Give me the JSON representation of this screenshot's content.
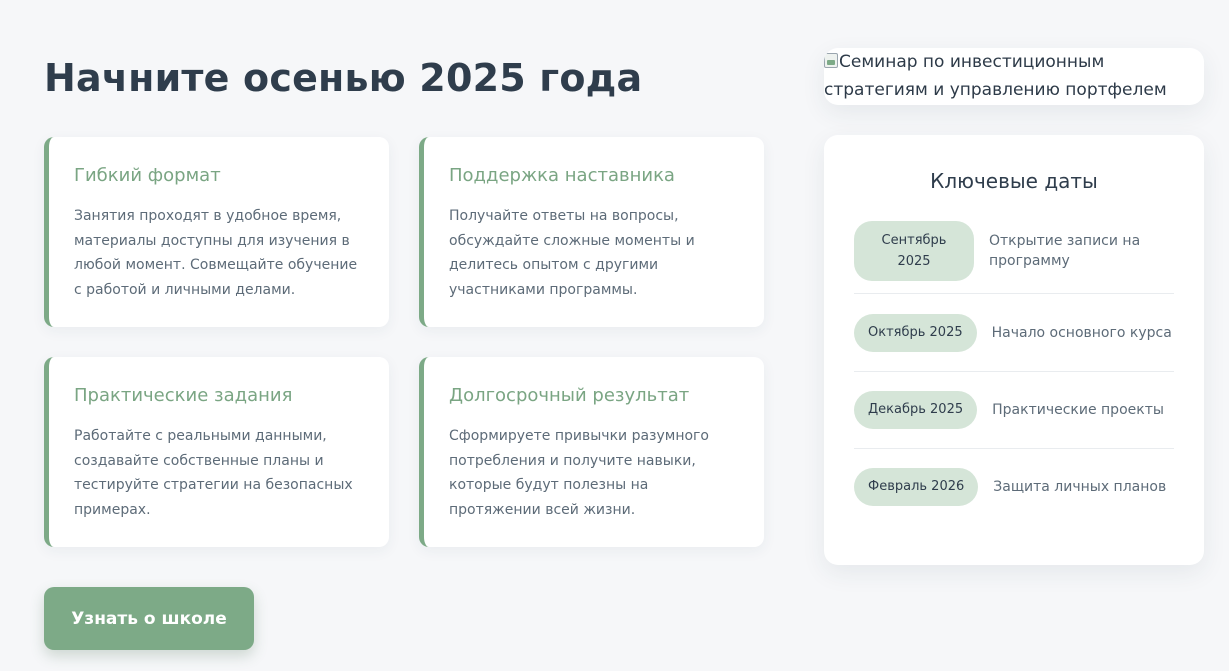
{
  "page": {
    "title": "Начните осенью 2025 года"
  },
  "features": [
    {
      "title": "Гибкий формат",
      "text": "Занятия проходят в удобное время, материалы доступны для изучения в любой момент. Совмещайте обучение с работой и личными делами."
    },
    {
      "title": "Поддержка наставника",
      "text": "Получайте ответы на вопросы, обсуждайте сложные моменты и делитесь опытом с другими участниками программы."
    },
    {
      "title": "Практические задания",
      "text": "Работайте с реальными данными, создавайте собственные планы и тестируйте стратегии на безопасных примерах."
    },
    {
      "title": "Долгосрочный результат",
      "text": "Сформируете привычки разумного потребления и получите навыки, которые будут полезны на протяжении всей жизни."
    }
  ],
  "cta": {
    "label": "Узнать о школе"
  },
  "hero_image": {
    "alt": "Семинар по инвестиционным стратегиям и управлению портфелем",
    "icon": "broken-image-icon"
  },
  "key_dates": {
    "title": "Ключевые даты",
    "items": [
      {
        "date": "Сентябрь 2025",
        "description": "Открытие записи на программу"
      },
      {
        "date": "Октябрь 2025",
        "description": "Начало основного курса"
      },
      {
        "date": "Декабрь 2025",
        "description": "Практические проекты"
      },
      {
        "date": "Февраль 2026",
        "description": "Защита личных планов"
      }
    ]
  },
  "colors": {
    "accent": "#7daa87",
    "pill_background": "#d5e5d8",
    "page_background": "#f6f7f9",
    "heading": "#2f3d4c"
  }
}
